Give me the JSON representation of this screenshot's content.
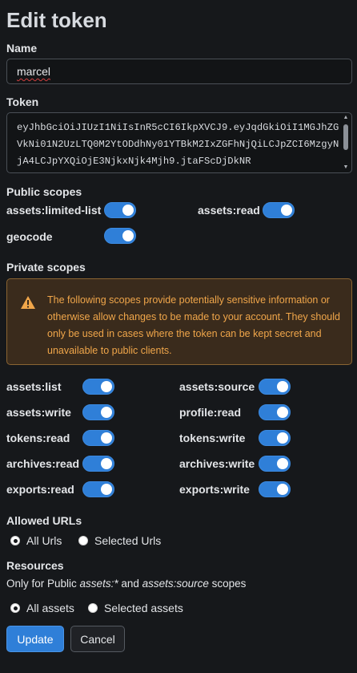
{
  "page": {
    "title": "Edit token"
  },
  "name_field": {
    "label": "Name",
    "value": "marcel"
  },
  "token_field": {
    "label": "Token",
    "value": "eyJhbGciOiJIUzI1NiIsInR5cCI6IkpXVCJ9.eyJqdGkiOiI1MGJhZGVkNi01N2UzLTQ0M2YtODdhNy01YTBkM2IxZGFhNjQiLCJpZCI6MzgyNjA4LCJpYXQiOjE3NjkxNjk4Mjh9.jtaFScDjDkNR"
  },
  "public_scopes": {
    "heading": "Public scopes",
    "items": [
      {
        "label": "assets:limited-list",
        "enabled": true
      },
      {
        "label": "assets:read",
        "enabled": true
      },
      {
        "label": "geocode",
        "enabled": true
      }
    ]
  },
  "private_scopes": {
    "heading": "Private scopes",
    "warning": "The following scopes provide potentially sensitive information or otherwise allow changes to be made to your account. They should only be used in cases where the token can be kept secret and unavailable to public clients.",
    "items": [
      {
        "label": "assets:list",
        "enabled": true
      },
      {
        "label": "assets:source",
        "enabled": true
      },
      {
        "label": "assets:write",
        "enabled": true
      },
      {
        "label": "profile:read",
        "enabled": true
      },
      {
        "label": "tokens:read",
        "enabled": true
      },
      {
        "label": "tokens:write",
        "enabled": true
      },
      {
        "label": "archives:read",
        "enabled": true
      },
      {
        "label": "archives:write",
        "enabled": true
      },
      {
        "label": "exports:read",
        "enabled": true
      },
      {
        "label": "exports:write",
        "enabled": true
      }
    ]
  },
  "allowed_urls": {
    "heading": "Allowed URLs",
    "options": [
      {
        "label": "All Urls",
        "selected": true
      },
      {
        "label": "Selected Urls",
        "selected": false
      }
    ]
  },
  "resources": {
    "heading": "Resources",
    "help_prefix": "Only for Public ",
    "help_scope1": "assets:*",
    "help_middle": " and ",
    "help_scope2": "assets:source",
    "help_suffix": " scopes",
    "options": [
      {
        "label": "All assets",
        "selected": true
      },
      {
        "label": "Selected assets",
        "selected": false
      }
    ]
  },
  "actions": {
    "update_label": "Update",
    "cancel_label": "Cancel"
  },
  "colors": {
    "accent": "#2f7fd8",
    "background": "#16181b",
    "warning_text": "#f0a64a",
    "warning_bg": "#3a2b1c"
  }
}
